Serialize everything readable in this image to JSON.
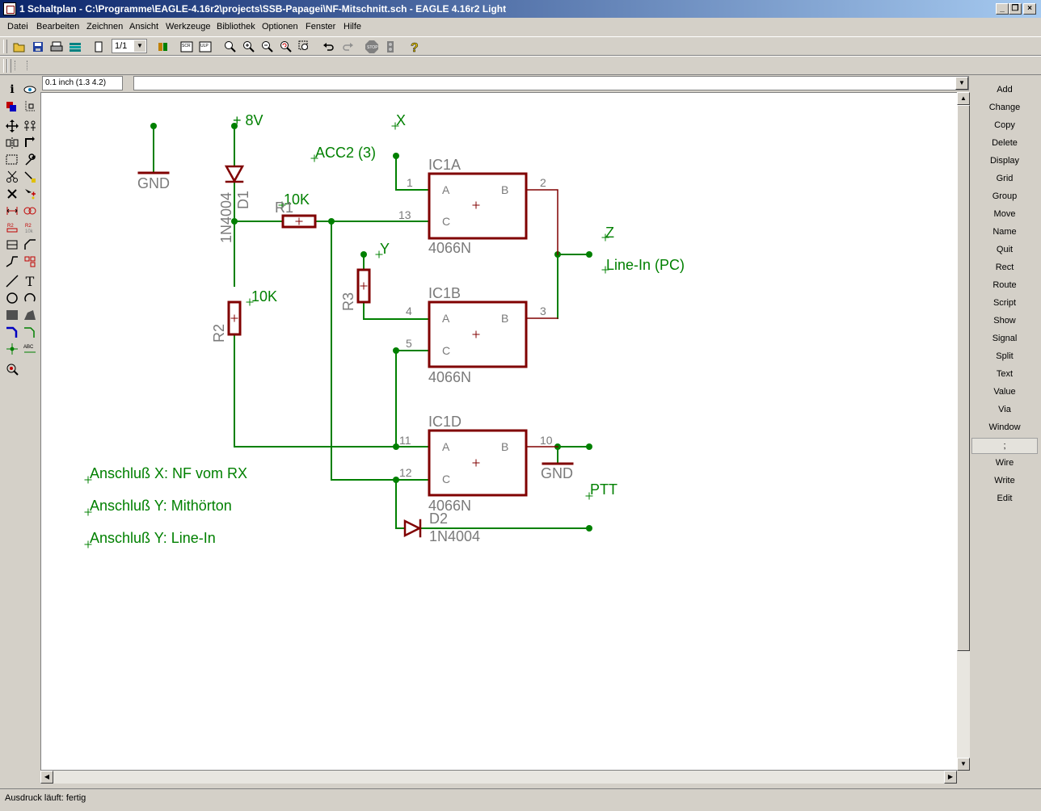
{
  "window": {
    "title": "1 Schaltplan - C:\\Programme\\EAGLE-4.16r2\\projects\\SSB-Papagei\\NF-Mitschnitt.sch - EAGLE 4.16r2 Light",
    "buttons": [
      "_",
      "❐",
      "×"
    ]
  },
  "menu": [
    "Datei",
    "Bearbeiten",
    "Zeichnen",
    "Ansicht",
    "Werkzeuge",
    "Bibliothek",
    "Optionen",
    "Fenster",
    "Hilfe"
  ],
  "toolbar": {
    "sheet_value": "1/1"
  },
  "coordinate_display": "0.1 inch (1.3 4.2)",
  "command_input": {
    "value": ""
  },
  "commands": [
    "Add",
    "Change",
    "Copy",
    "Delete",
    "Display",
    "Grid",
    "Group",
    "Move",
    "Name",
    "Quit",
    "Rect",
    "Route",
    "Script",
    "Show",
    "Signal",
    "Split",
    "Text",
    "Value",
    "Via",
    "Window",
    ";",
    "Wire",
    "Write",
    "Edit"
  ],
  "status": "Ausdruck läuft: fertig",
  "schematic": {
    "colors": {
      "net": "#008000",
      "part": "#800000",
      "label": "#7a7a7a",
      "background": "#ffffff"
    },
    "supply_labels": [
      "GND",
      "+ 8V",
      "GND"
    ],
    "net_labels": [
      "X",
      "ACC2 (3)",
      "Y",
      "Z",
      "Line-In (PC)",
      "PTT"
    ],
    "parts": {
      "ic1a": {
        "name": "IC1A",
        "value": "4066N",
        "pins": [
          "1",
          "13",
          "2"
        ],
        "pin_letters": [
          "A",
          "B",
          "C"
        ]
      },
      "ic1b": {
        "name": "IC1B",
        "value": "4066N",
        "pins": [
          "4",
          "5",
          "3"
        ],
        "pin_letters": [
          "A",
          "B",
          "C"
        ]
      },
      "ic1d": {
        "name": "IC1D",
        "value": "4066N",
        "pins": [
          "11",
          "12",
          "10"
        ],
        "pin_letters": [
          "A",
          "B",
          "C"
        ]
      },
      "d1": {
        "name": "D1",
        "value": "1N4004"
      },
      "d2": {
        "name": "D2",
        "value": "1N4004"
      },
      "r1": {
        "name": "R1",
        "value": "10K"
      },
      "r2": {
        "name": "R2",
        "value": "10K"
      },
      "r3": {
        "name": "R3"
      }
    },
    "notes": [
      "Anschluß X:  NF vom RX",
      "Anschluß Y:  Mithörton",
      "Anschluß Y: Line-In"
    ]
  }
}
